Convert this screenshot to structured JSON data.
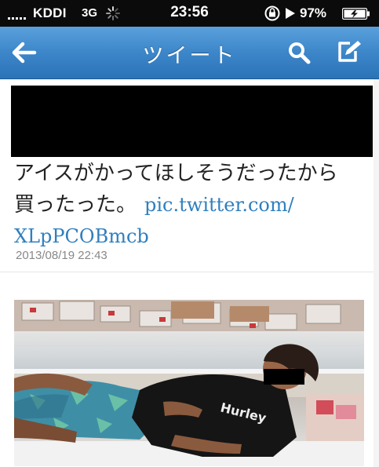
{
  "status_bar": {
    "carrier": "KDDI",
    "network": "3G",
    "time": "23:56",
    "battery_percent": "97%",
    "icons": [
      "signal-icon",
      "loading-spinner-icon",
      "rotation-lock-icon",
      "play-icon",
      "battery-charging-icon"
    ]
  },
  "nav": {
    "title": "ツイート",
    "icons": [
      "back-arrow-icon",
      "search-icon",
      "compose-icon"
    ]
  },
  "tweet": {
    "text_line1": "アイスがかってほしそうだったから",
    "text_line2_prefix": "買ったった。",
    "link_part1": "pic.twitter.com/",
    "link_part2": "XLpPCOBmcb",
    "timestamp": "2013/08/19 22:43"
  },
  "photo": {
    "shirt_brand": "Hurley"
  },
  "colors": {
    "nav_top": "#5aa0dc",
    "nav_bottom": "#2b73b7",
    "link": "#2f7fbe",
    "timestamp": "#888888"
  }
}
